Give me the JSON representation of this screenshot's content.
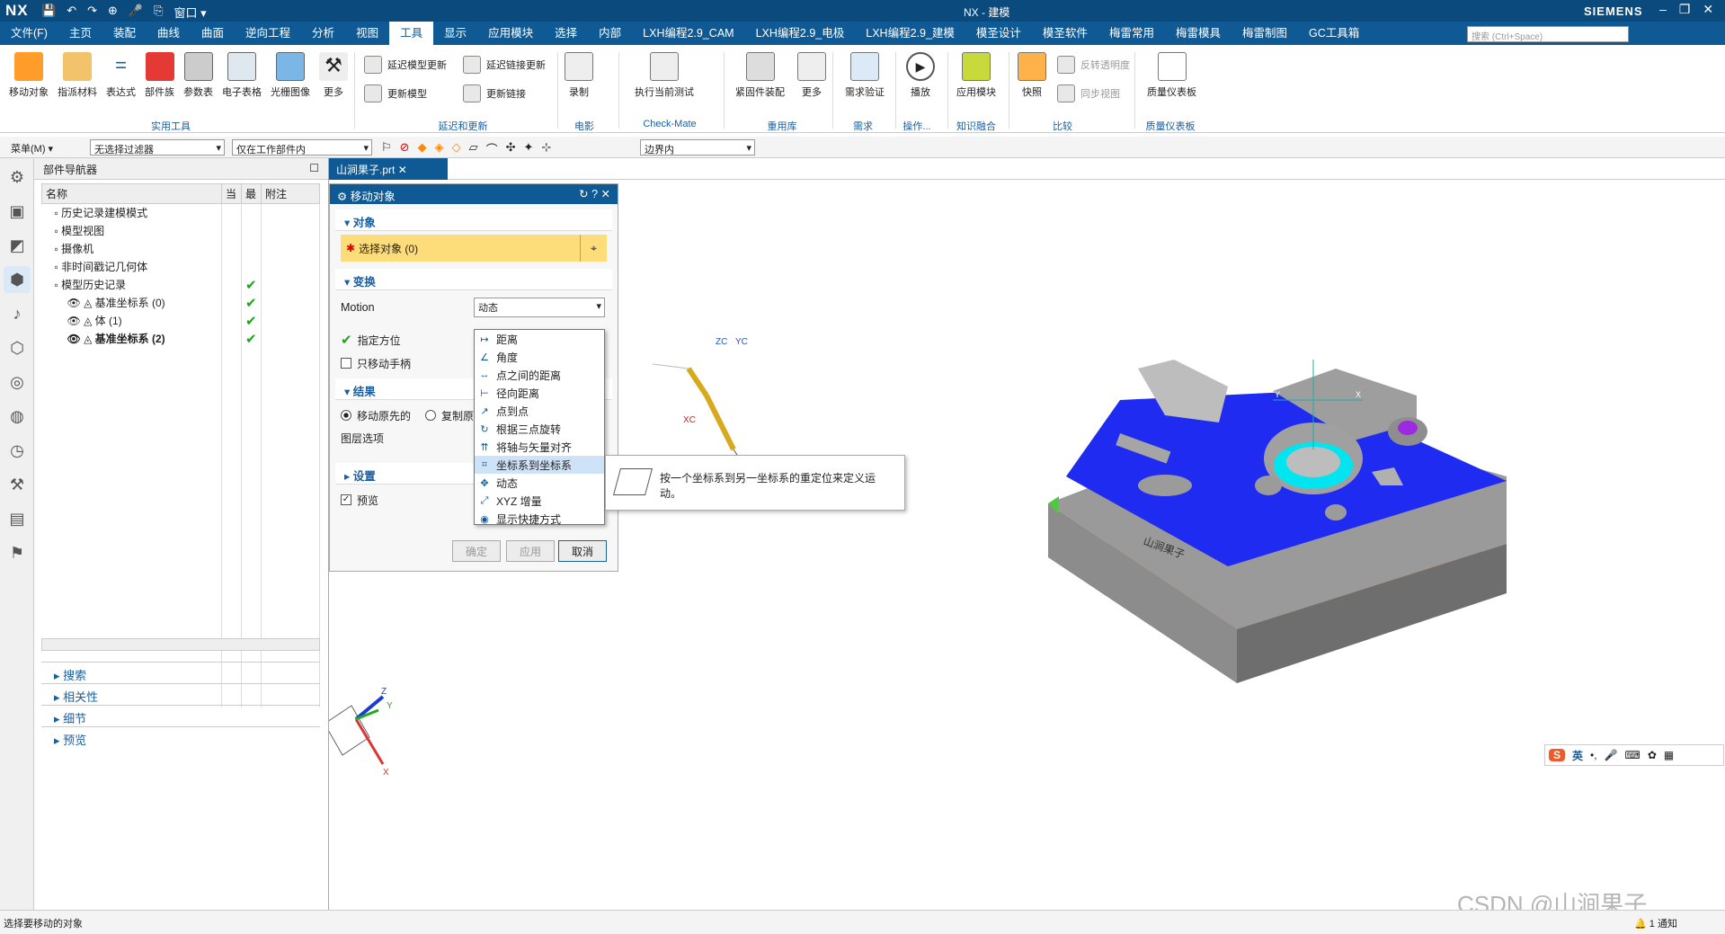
{
  "app": {
    "logo": "NX",
    "window_title": "NX - 建模",
    "brand": "SIEMENS",
    "quick_access": [
      "💾",
      "↶",
      "↷",
      "⊕",
      "🎤",
      "⎘",
      "窗口 ▾"
    ]
  },
  "menu": [
    "文件(F)",
    "主页",
    "装配",
    "曲线",
    "曲面",
    "逆向工程",
    "分析",
    "视图",
    "工具",
    "显示",
    "应用模块",
    "选择",
    "内部",
    "LXH编程2.9_CAM",
    "LXH编程2.9_电极",
    "LXH编程2.9_建模",
    "模圣设计",
    "模圣软件",
    "梅雷常用",
    "梅雷模具",
    "梅雷制图",
    "GC工具箱"
  ],
  "menu_active": "工具",
  "search": {
    "placeholder": "搜索 (Ctrl+Space)"
  },
  "ribbon": {
    "practical": [
      "移动对象",
      "指派材料",
      "表达式",
      "部件族",
      "参数表",
      "电子表格",
      "光栅图像",
      "更多"
    ],
    "practical_group": "实用工具",
    "update_small": [
      "延迟模型更新",
      "延迟链接更新",
      "更新模型",
      "更新链接"
    ],
    "update_group": "延迟和更新",
    "record": "录制",
    "record_group": "电影",
    "checkmate": "执行当前测试",
    "checkmate_group": "Check-Mate",
    "reuse": [
      "紧固件装配",
      "更多"
    ],
    "reuse_group": "重用库",
    "req": "需求验证",
    "req_group": "需求",
    "play": "播放",
    "play_group": "操作...",
    "apps": "应用模块",
    "apps_group": "知识融合",
    "snap": "快照",
    "snap_small": [
      "反转透明度",
      "同步视图"
    ],
    "snap_group": "比较",
    "quality": "质量仪表板",
    "quality_group": "质量仪表板"
  },
  "selbar": {
    "menu": "菜单(M) ▾",
    "filter": "无选择过滤器",
    "scope": "仅在工作部件内",
    "boundary": "边界内"
  },
  "navigator": {
    "title": "部件导航器",
    "columns": [
      "名称",
      "当",
      "最",
      "附注"
    ],
    "rows": [
      {
        "label": "历史记录建模模式",
        "indent": 1,
        "check": ""
      },
      {
        "label": "模型视图",
        "indent": 1,
        "check": ""
      },
      {
        "label": "摄像机",
        "indent": 1,
        "check": ""
      },
      {
        "label": "非时间戳记几何体",
        "indent": 1,
        "check": ""
      },
      {
        "label": "模型历史记录",
        "indent": 1,
        "check": "✔"
      },
      {
        "label": "基准坐标系 (0)",
        "indent": 2,
        "check": "✔"
      },
      {
        "label": "体 (1)",
        "indent": 2,
        "check": "✔"
      },
      {
        "label": "基准坐标系 (2)",
        "indent": 2,
        "check": "✔"
      }
    ],
    "bottom": [
      "搜索",
      "相关性",
      "细节",
      "预览"
    ]
  },
  "tab": {
    "label": "山涧果子.prt"
  },
  "dialog": {
    "title": "移动对象",
    "sec_object": "对象",
    "select_label": "选择对象 (0)",
    "sec_transform": "变换",
    "motion_label": "Motion",
    "motion_value": "动态",
    "specify": "指定方位",
    "only_handle": "只移动手柄",
    "sec_result": "结果",
    "move_orig": "移动原先的",
    "copy_orig": "复制原",
    "layer_opt": "图层选项",
    "sec_settings": "设置",
    "preview": "预览",
    "ok": "确定",
    "apply": "应用",
    "cancel": "取消"
  },
  "dropdown": [
    {
      "icon": "↦",
      "label": "距离"
    },
    {
      "icon": "∠",
      "label": "角度"
    },
    {
      "icon": "↔",
      "label": "点之间的距离"
    },
    {
      "icon": "⊢",
      "label": "径向距离"
    },
    {
      "icon": "↗",
      "label": "点到点"
    },
    {
      "icon": "↻",
      "label": "根据三点旋转"
    },
    {
      "icon": "⇈",
      "label": "将轴与矢量对齐"
    },
    {
      "icon": "⌗",
      "label": "坐标系到坐标系"
    },
    {
      "icon": "✥",
      "label": "动态"
    },
    {
      "icon": "⤢",
      "label": "XYZ 增量"
    },
    {
      "icon": "◉",
      "label": "显示快捷方式"
    }
  ],
  "dropdown_highlight": 7,
  "tooltip": "按一个坐标系到另一坐标系的重定位来定义运动。",
  "model": {
    "engraving": "山涧果子"
  },
  "csys_labels": {
    "zc": "ZC",
    "yc": "YC",
    "xc": "XC",
    "z": "Z",
    "y": "Y",
    "x": "X"
  },
  "ime": {
    "lang": "英",
    "logo": "S"
  },
  "status": {
    "text": "选择要移动的对象",
    "notify": "1 通知"
  },
  "watermark": "CSDN @山涧果子",
  "colors": {
    "title": "#0b4a7d",
    "menu": "#0f5a94",
    "accent": "#1a5fa0",
    "blue": "#1f2bf0",
    "orange": "#ff8a1f",
    "cyan": "#00e5f0",
    "gray": "#8e8e8e"
  }
}
